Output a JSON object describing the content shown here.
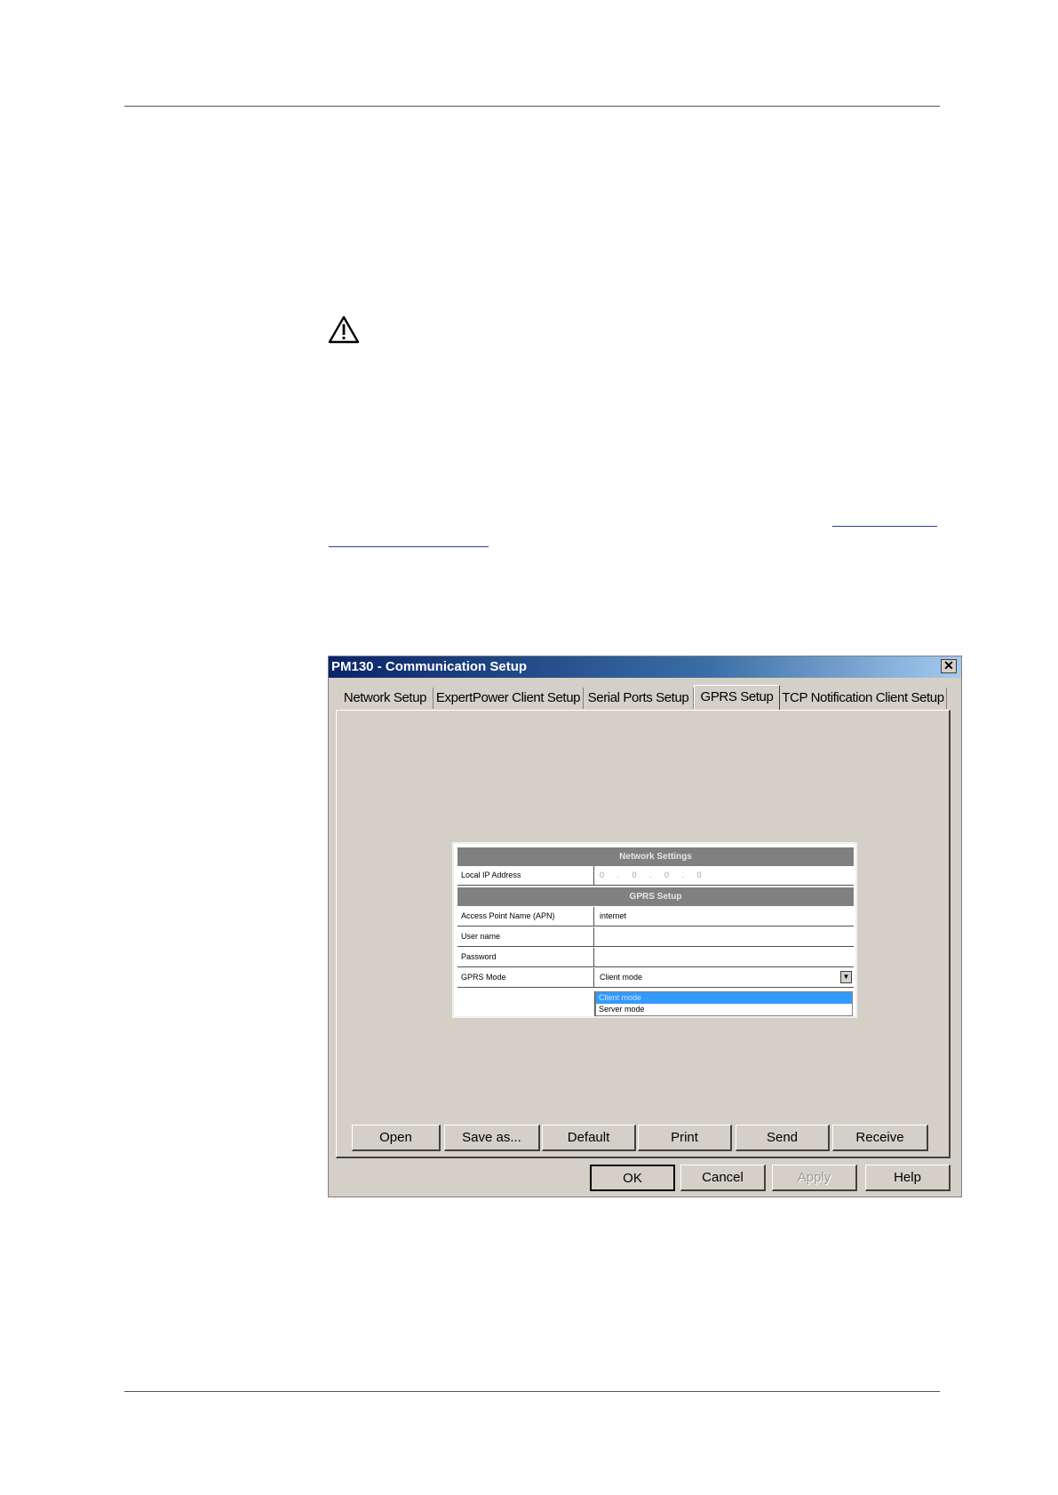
{
  "dialog": {
    "title": "PM130 - Communication Setup",
    "close_symbol": "✕",
    "tabs": [
      {
        "label": "Network Setup"
      },
      {
        "label": "ExpertPower Client Setup"
      },
      {
        "label": "Serial Ports Setup"
      },
      {
        "label": "GPRS Setup"
      },
      {
        "label": "TCP Notification Client Setup"
      }
    ],
    "active_tab": "GPRS Setup",
    "network_section": "Network Settings",
    "local_ip_label": "Local IP Address",
    "local_ip_value": "0 . 0 . 0 . 0",
    "gprs_section": "GPRS Setup",
    "apn_label": "Access Point Name (APN)",
    "apn_value": "internet",
    "user_label": "User name",
    "user_value": "",
    "password_label": "Password",
    "password_value": "",
    "mode_label": "GPRS Mode",
    "mode_value": "Client mode",
    "mode_options": [
      "Client mode",
      "Server mode"
    ],
    "buttons": {
      "open": "Open",
      "save_as": "Save as...",
      "default": "Default",
      "print": "Print",
      "send": "Send",
      "receive": "Receive",
      "ok": "OK",
      "cancel": "Cancel",
      "apply": "Apply",
      "help": "Help"
    }
  }
}
